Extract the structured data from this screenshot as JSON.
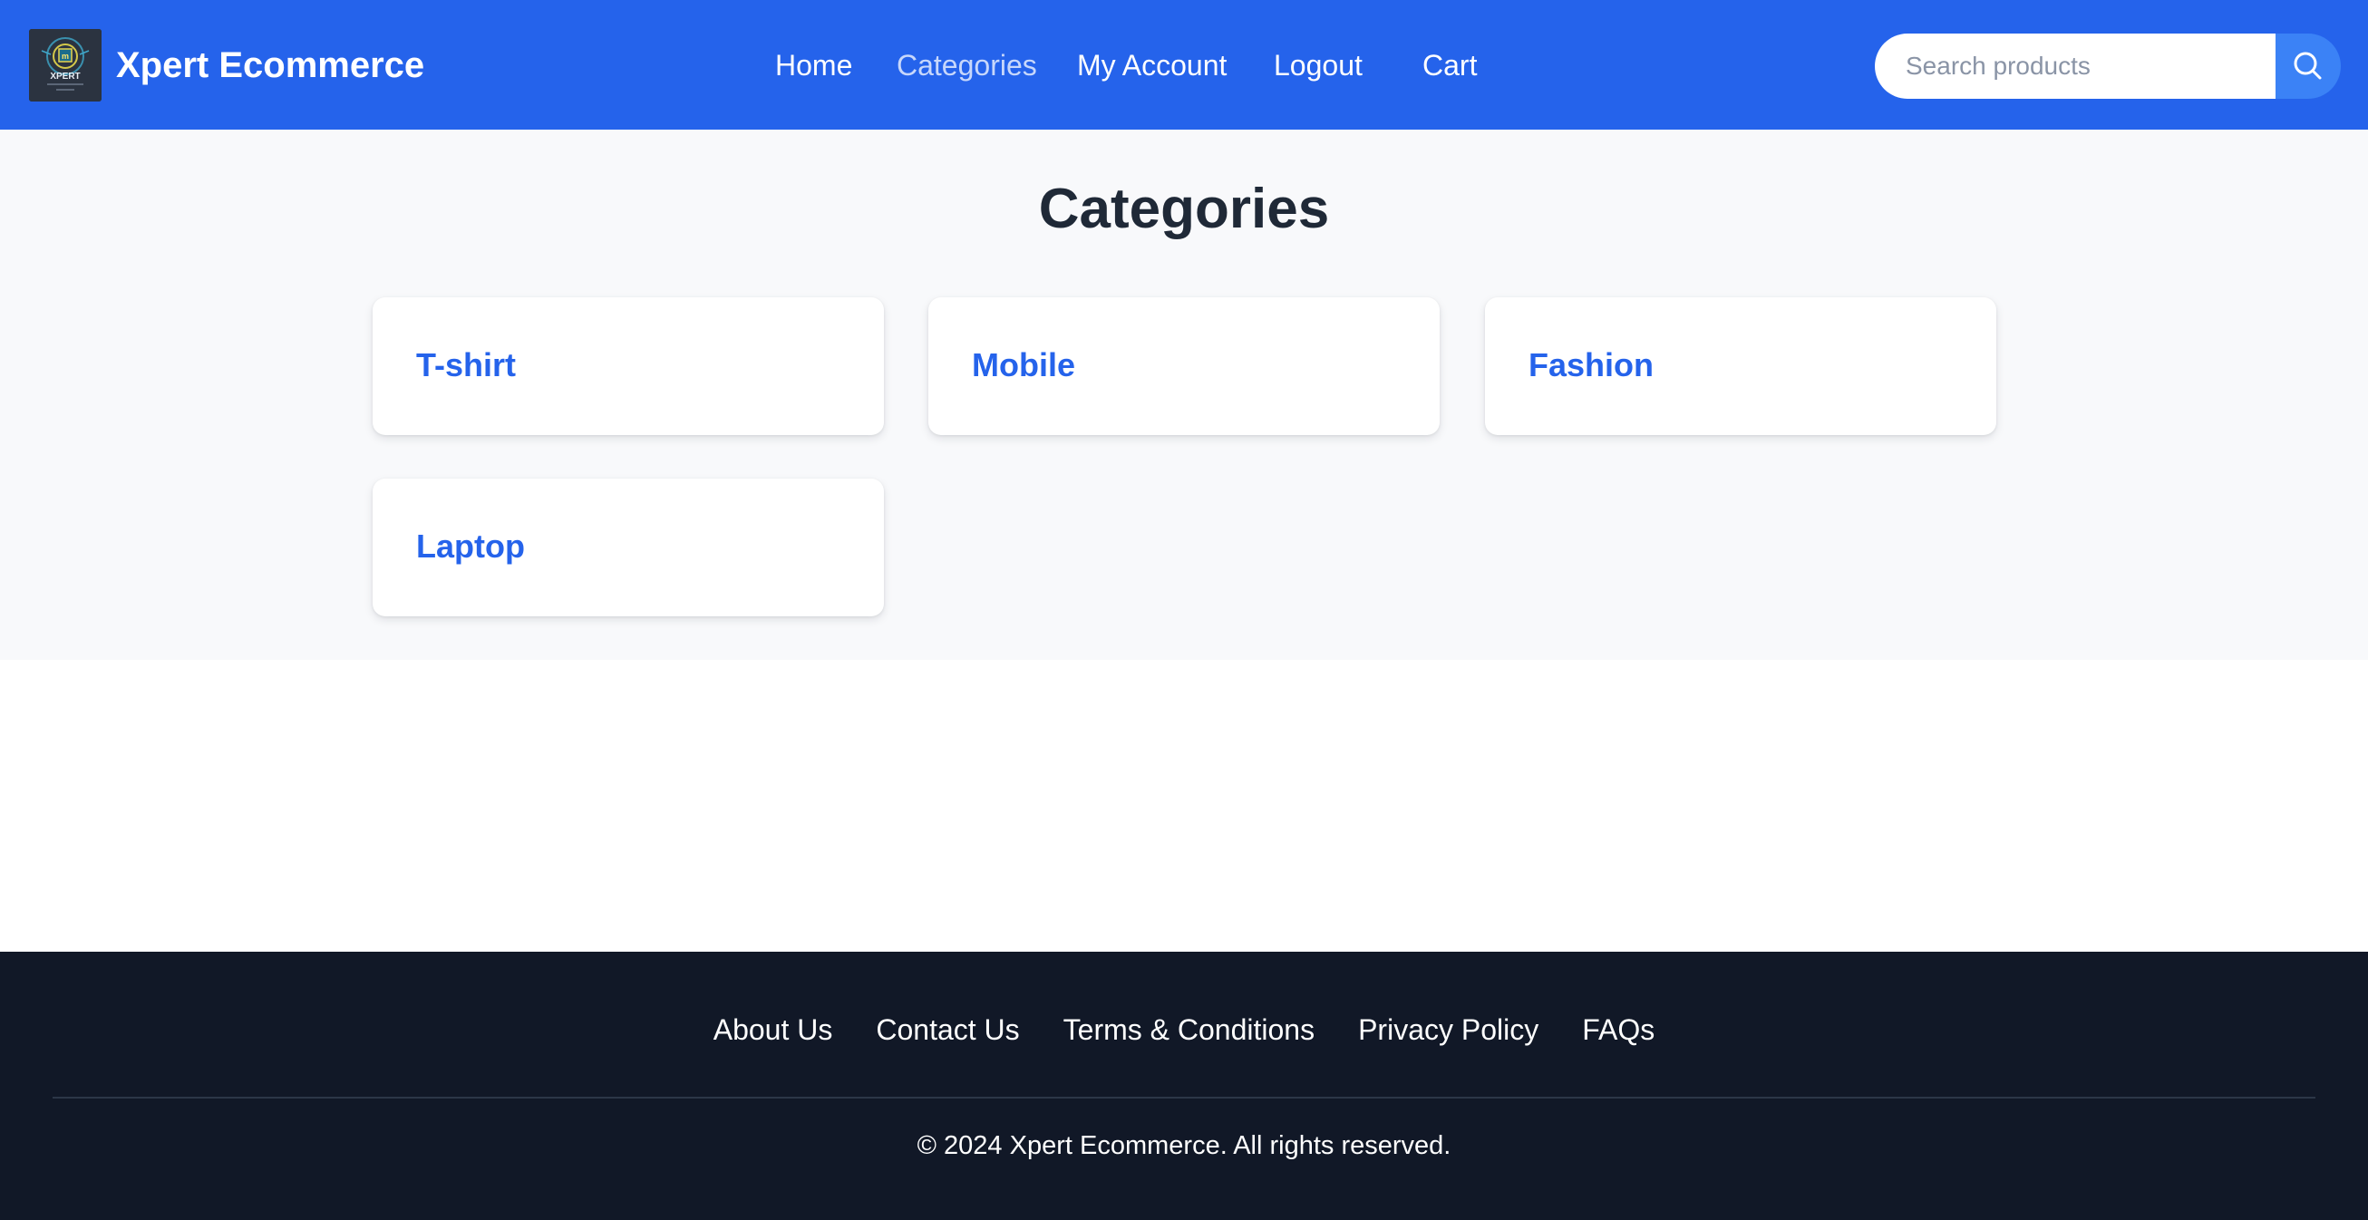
{
  "header": {
    "brand": "Xpert Ecommerce",
    "logo_icon": "xpert-logo-icon",
    "logo_text": "XPERT",
    "nav": [
      {
        "label": "Home",
        "active": false
      },
      {
        "label": "Categories",
        "active": true
      },
      {
        "label": "My Account",
        "active": false
      },
      {
        "label": "Logout",
        "active": false
      },
      {
        "label": "Cart",
        "active": false
      }
    ],
    "search": {
      "placeholder": "Search products",
      "value": "",
      "button_icon": "search-icon"
    }
  },
  "main": {
    "title": "Categories",
    "categories": [
      {
        "label": "T-shirt"
      },
      {
        "label": "Mobile"
      },
      {
        "label": "Fashion"
      },
      {
        "label": "Laptop"
      }
    ]
  },
  "footer": {
    "links": [
      {
        "label": "About Us"
      },
      {
        "label": "Contact Us"
      },
      {
        "label": "Terms & Conditions"
      },
      {
        "label": "Privacy Policy"
      },
      {
        "label": "FAQs"
      }
    ],
    "copyright": "© 2024 Xpert Ecommerce. All rights reserved."
  },
  "colors": {
    "header_bg": "#2563eb",
    "accent": "#2563eb",
    "search_button": "#3b82f6",
    "page_bg": "#f8f9fb",
    "footer_bg": "#111827",
    "title_text": "#1f2937"
  }
}
